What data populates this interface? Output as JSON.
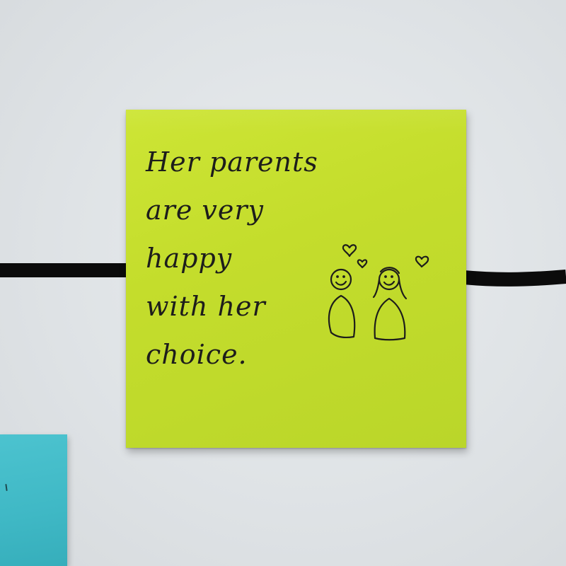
{
  "scene": {
    "background_color": "#e2e6e8",
    "tape_color": "#0b0b0b"
  },
  "main_note": {
    "color": "#c7e02e",
    "text_lines": [
      "Her parents",
      "are very",
      "happy",
      "with her",
      "choice."
    ],
    "ink_color": "#1d1d1b"
  },
  "doodle": {
    "figures": 2,
    "hearts": 3
  },
  "secondary_note": {
    "color": "#43bcc8"
  }
}
